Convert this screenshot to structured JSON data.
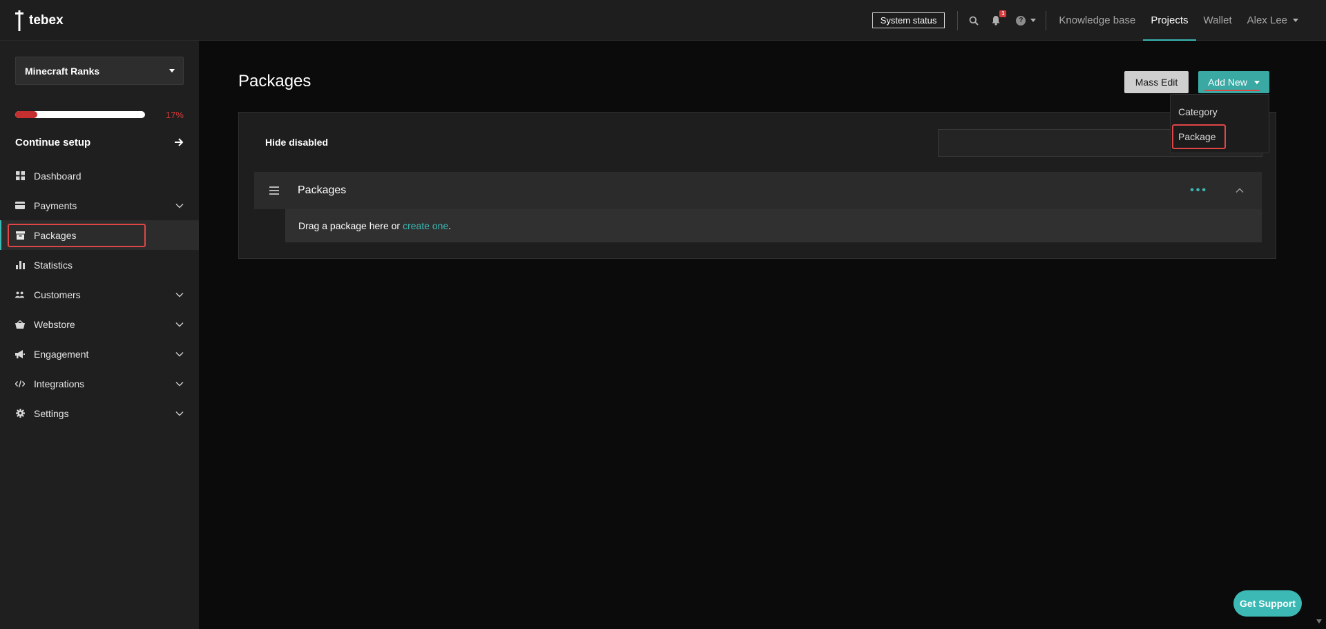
{
  "brand": {
    "name": "tebex"
  },
  "header": {
    "system_status": "System status",
    "notifications_count": "1",
    "nav": [
      {
        "label": "Knowledge base",
        "active": false
      },
      {
        "label": "Projects",
        "active": true
      },
      {
        "label": "Wallet",
        "active": false
      }
    ],
    "user_name": "Alex Lee"
  },
  "sidebar": {
    "project": "Minecraft Ranks",
    "progress_percent": 17,
    "progress_label": "17%",
    "continue_setup": "Continue setup",
    "items": [
      {
        "label": "Dashboard",
        "icon": "grid-icon",
        "has_children": false,
        "active": false
      },
      {
        "label": "Payments",
        "icon": "credit-card-icon",
        "has_children": true,
        "active": false
      },
      {
        "label": "Packages",
        "icon": "box-icon",
        "has_children": false,
        "active": true
      },
      {
        "label": "Statistics",
        "icon": "bar-chart-icon",
        "has_children": false,
        "active": false
      },
      {
        "label": "Customers",
        "icon": "users-icon",
        "has_children": true,
        "active": false
      },
      {
        "label": "Webstore",
        "icon": "basket-icon",
        "has_children": true,
        "active": false
      },
      {
        "label": "Engagement",
        "icon": "megaphone-icon",
        "has_children": true,
        "active": false
      },
      {
        "label": "Integrations",
        "icon": "code-icon",
        "has_children": true,
        "active": false
      },
      {
        "label": "Settings",
        "icon": "gear-icon",
        "has_children": true,
        "active": false
      }
    ]
  },
  "main": {
    "title": "Packages",
    "mass_edit": "Mass Edit",
    "add_new": "Add New",
    "add_new_menu": [
      "Category",
      "Package"
    ],
    "hide_disabled": "Hide disabled",
    "category": {
      "title": "Packages",
      "dots": "•••",
      "empty_text": "Drag a package here or",
      "empty_link": "create one",
      "empty_suffix": "."
    }
  },
  "support": {
    "label": "Get Support"
  },
  "colors": {
    "accent": "#3cb9b4",
    "danger": "#e04646",
    "sidebar_bg": "#1f1f20",
    "page_bg": "#0b0b0c"
  }
}
